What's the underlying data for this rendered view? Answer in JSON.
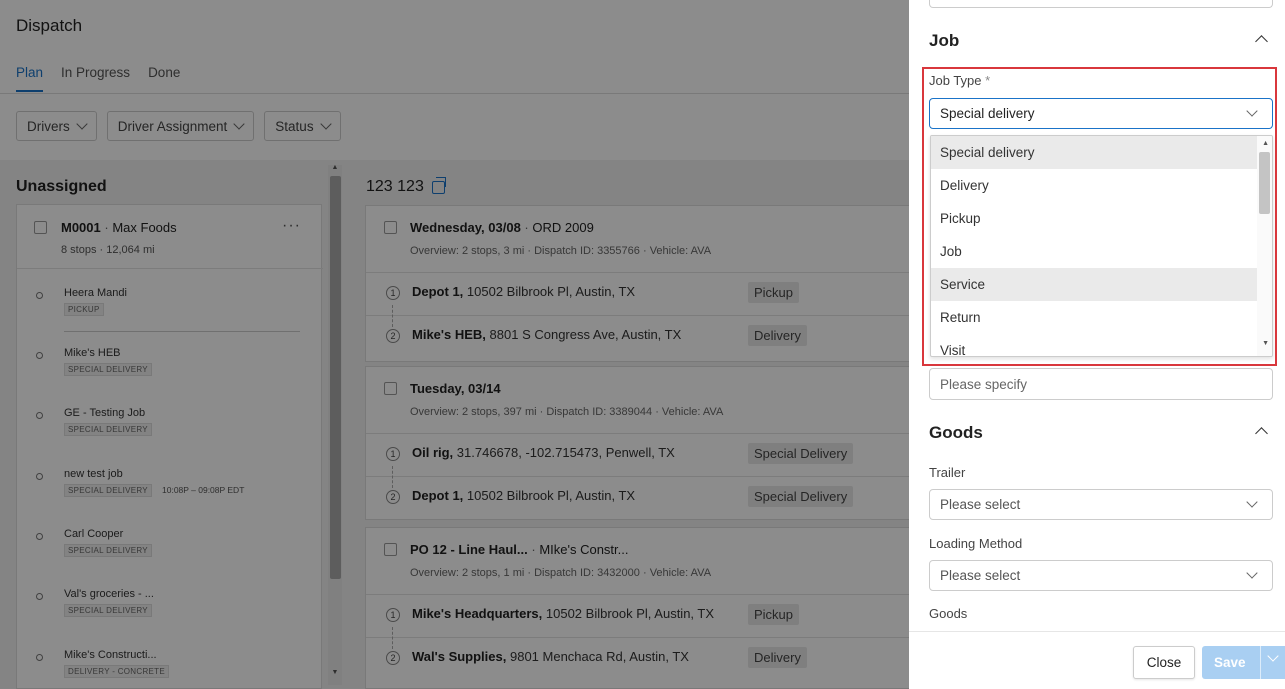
{
  "app": {
    "title": "Dispatch",
    "tabs": [
      "Plan",
      "In Progress",
      "Done"
    ],
    "filters": [
      "Drivers",
      "Driver Assignment",
      "Status"
    ]
  },
  "unassigned": {
    "title": "Unassigned",
    "customer_code": "M0001",
    "customer_name": "Max Foods",
    "stops_count": "8 stops",
    "distance": "12,064 mi",
    "more": "···",
    "stops": [
      {
        "name": "Heera Mandi",
        "tag": "PICKUP",
        "time": ""
      },
      {
        "name": "Mike's HEB",
        "tag": "SPECIAL DELIVERY",
        "time": ""
      },
      {
        "name": "GE - Testing Job",
        "tag": "SPECIAL DELIVERY",
        "time": ""
      },
      {
        "name": "new test job",
        "tag": "SPECIAL DELIVERY",
        "time": "10:08P – 09:08P EDT"
      },
      {
        "name": "Carl Cooper",
        "tag": "SPECIAL DELIVERY",
        "time": ""
      },
      {
        "name": "Val's groceries - ...",
        "tag": "SPECIAL DELIVERY",
        "time": ""
      },
      {
        "name": "Mike's Constructi...",
        "tag": "DELIVERY - CONCRETE",
        "time": ""
      }
    ]
  },
  "driver": {
    "name": "123 123",
    "routes": [
      {
        "date": "Wednesday, 03/08",
        "ref": "ORD 2009",
        "overview": "Overview: 2 stops, 3 mi",
        "dispatch": "Dispatch ID: 3355766",
        "vehicle": "Vehicle: AVA",
        "stops": [
          {
            "num": "1",
            "place": "Depot 1,",
            "addr": "10502 Bilbrook Pl, Austin, TX",
            "type": "Pickup"
          },
          {
            "num": "2",
            "place": "Mike's HEB,",
            "addr": "8801 S Congress Ave, Austin, TX",
            "type": "Delivery"
          }
        ]
      },
      {
        "date": "Tuesday, 03/14",
        "ref": "",
        "overview": "Overview: 2 stops, 397 mi",
        "dispatch": "Dispatch ID: 3389044",
        "vehicle": "Vehicle: AVA",
        "stops": [
          {
            "num": "1",
            "place": "Oil rig,",
            "addr": "31.746678, -102.715473, Penwell, TX",
            "type": "Special Delivery"
          },
          {
            "num": "2",
            "place": "Depot 1,",
            "addr": "10502 Bilbrook Pl, Austin, TX",
            "type": "Special Delivery"
          }
        ]
      },
      {
        "date": "PO 12 - Line Haul...",
        "ref": "MIke's Constr...",
        "overview": "Overview: 2 stops, 1 mi",
        "dispatch": "Dispatch ID: 3432000",
        "vehicle": "Vehicle: AVA",
        "stops": [
          {
            "num": "1",
            "place": "Mike's Headquarters,",
            "addr": "10502 Bilbrook Pl, Austin, TX",
            "type": "Pickup"
          },
          {
            "num": "2",
            "place": "Wal's Supplies,",
            "addr": "9801 Menchaca Rd, Austin, TX",
            "type": "Delivery"
          }
        ]
      }
    ]
  },
  "panel": {
    "job_section": "Job",
    "job_type_label": "Job Type",
    "required_mark": "*",
    "job_type_value": "Special delivery",
    "job_type_options": [
      "Special delivery",
      "Delivery",
      "Pickup",
      "Job",
      "Service",
      "Return",
      "Visit"
    ],
    "highlighted_option": "Service",
    "specify_placeholder": "Please specify",
    "goods_section": "Goods",
    "trailer_label": "Trailer",
    "trailer_value": "Please select",
    "loading_label": "Loading Method",
    "loading_value": "Please select",
    "goods_label": "Goods",
    "close_label": "Close",
    "save_label": "Save"
  },
  "colors": {
    "accent": "#1a73c8",
    "highlight_box": "#d9373c",
    "save_disabled": "#a9cff2"
  }
}
